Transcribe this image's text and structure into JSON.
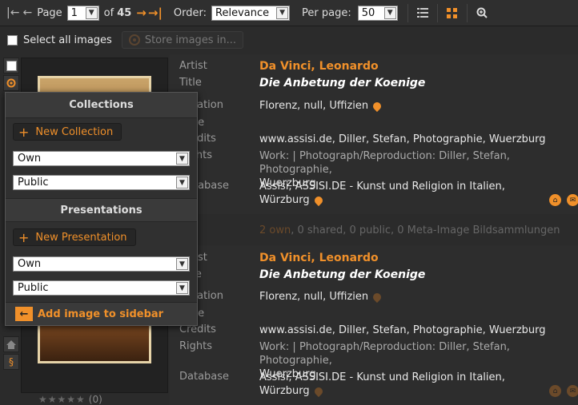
{
  "toolbar": {
    "page_label": "Page",
    "page_value": "1",
    "of_text": "of",
    "total_pages": "45",
    "order_label": "Order:",
    "order_value": "Relevance",
    "per_page_label": "Per page:",
    "per_page_value": "50",
    "icons": [
      "first-page-icon",
      "prev-page-icon",
      "next-page-icon",
      "last-page-icon",
      "list-view-icon",
      "grid-view-icon",
      "zoom-icon"
    ]
  },
  "selection": {
    "select_all_label": "Select all images",
    "store_button_label": "Store images in..."
  },
  "records": [
    {
      "artist_label": "Artist",
      "artist": "Da Vinci, Leonardo",
      "title_label": "Title",
      "title": "Die Anbetung der Koenige",
      "location_label": "Location",
      "location": "Florenz, null, Uffizien",
      "date_label": "Date",
      "credits_label": "Credits",
      "credits": "www.assisi.de, Diller, Stefan, Photographie, Wuerzburg",
      "rights_label": "Rights",
      "rights_line1": "Work: | Photograph/Reproduction: Diller, Stefan, Photographie,",
      "rights_line2": "Wuerzburg",
      "database_label": "Database",
      "database_line1": "Assisi, ASSISI.DE - Kunst und Religion in Italien,",
      "database_line2": "Würzburg"
    },
    {
      "artist_label": "Artist",
      "artist": "Da Vinci, Leonardo",
      "title_label": "Title",
      "title": "Die Anbetung der Koenige",
      "location_label": "Location",
      "location": "Florenz, null, Uffizien",
      "date_label": "Date",
      "credits_label": "Credits",
      "credits": "www.assisi.de, Diller, Stefan, Photographie, Wuerzburg",
      "rights_label": "Rights",
      "rights_line1": "Work: | Photograph/Reproduction: Diller, Stefan, Photographie,",
      "rights_line2": "Wuerzburg",
      "database_label": "Database",
      "database_line1": "Assisi, ASSISI.DE - Kunst und Religion in Italien,",
      "database_line2": "Würzburg"
    }
  ],
  "share_bar": {
    "own": "2 own",
    "rest": ", 0 shared, 0 public, 0 Meta-Image Bildsammlungen"
  },
  "rating": {
    "stars": "★★★★★",
    "count": "(0)"
  },
  "popup": {
    "collections_title": "Collections",
    "new_collection_label": "New Collection",
    "collections_select_1": "Own",
    "collections_select_2": "Public",
    "presentations_title": "Presentations",
    "new_presentation_label": "New Presentation",
    "presentations_select_1": "Own",
    "presentations_select_2": "Public",
    "add_to_sidebar_label": "Add image to sidebar"
  },
  "colors": {
    "accent": "#f0902a",
    "background": "#2b2b2b"
  }
}
